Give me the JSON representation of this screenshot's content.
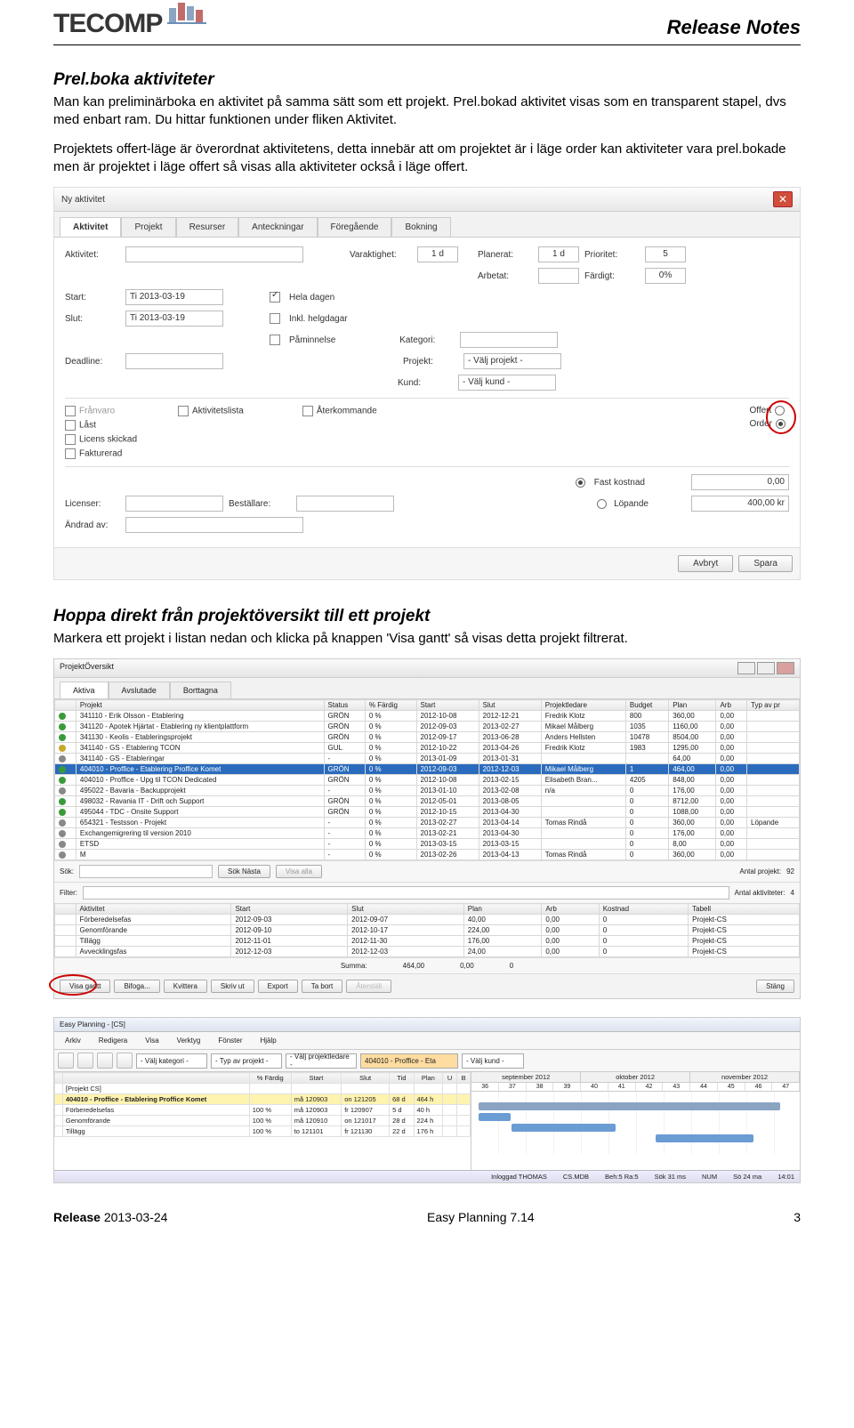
{
  "header": {
    "logo_text": "TECOMP",
    "title": "Release Notes"
  },
  "sec1": {
    "heading": "Prel.boka aktiviteter",
    "p1": "Man kan preliminärboka en aktivitet på samma sätt som ett projekt. Prel.bokad aktivitet visas som en transparent stapel, dvs med enbart ram. Du hittar funktionen under fliken Aktivitet.",
    "p2": "Projektets offert-läge är överordnat aktivitetens, detta innebär att om projektet är i läge order kan aktiviteter vara prel.bokade men är projektet i läge offert så visas alla aktiviteter också i läge offert."
  },
  "dlg": {
    "title": "Ny aktivitet",
    "tabs": [
      "Aktivitet",
      "Projekt",
      "Resurser",
      "Anteckningar",
      "Föregående",
      "Bokning"
    ],
    "labels": {
      "aktivitet": "Aktivitet:",
      "varaktighet": "Varaktighet:",
      "planerat": "Planerat:",
      "prioritet": "Prioritet:",
      "arbetat": "Arbetat:",
      "fardigt": "Färdigt:",
      "start": "Start:",
      "slut": "Slut:",
      "heladagen": "Hela dagen",
      "inkl": "Inkl. helgdagar",
      "paminnelse": "Påminnelse",
      "kategori": "Kategori:",
      "projekt": "Projekt:",
      "kund": "Kund:",
      "deadline": "Deadline:",
      "franvaro": "Frånvaro",
      "aktivitetslista": "Aktivitetslista",
      "aterkommande": "Återkommande",
      "last": "Låst",
      "licens": "Licens skickad",
      "fakturerad": "Fakturerad",
      "offert": "Offert",
      "order": "Order",
      "fastkostnad": "Fast kostnad",
      "lopande": "Löpande",
      "licenser": "Licenser:",
      "bestallare": "Beställare:",
      "andrad": "Ändrad av:"
    },
    "values": {
      "varaktighet": "1 d",
      "planerat": "1 d",
      "prioritet": "5",
      "fardigt": "0%",
      "start": "Ti 2013-03-19",
      "slut": "Ti 2013-03-19",
      "projekt": "- Välj projekt -",
      "kund": "- Välj kund -",
      "fastkostnad": "0,00",
      "lopande": "400,00 kr"
    },
    "buttons": {
      "avbryt": "Avbryt",
      "spara": "Spara"
    }
  },
  "sec2": {
    "heading": "Hoppa direkt från projektöversikt till ett projekt",
    "p": "Markera ett projekt i listan nedan och klicka på knappen 'Visa gantt' så visas detta projekt filtrerat."
  },
  "ov": {
    "title": "ProjektÖversikt",
    "tabs": [
      "Aktiva",
      "Avslutade",
      "Borttagna"
    ],
    "cols": [
      "",
      "Projekt",
      "Status",
      "% Färdig",
      "Start",
      "Slut",
      "Projektledare",
      "Budget",
      "Plan",
      "Arb",
      "Typ av pr"
    ],
    "rows": [
      [
        "g",
        "341110 - Erik Olsson - Etablering",
        "GRÖN",
        "0 %",
        "2012-10-08",
        "2012-12-21",
        "Fredrik Klotz",
        "800",
        "360,00",
        "0,00",
        ""
      ],
      [
        "g",
        "341120 - Apotek Hjärtat - Etablering ny klientplattform",
        "GRÖN",
        "0 %",
        "2012-09-03",
        "2013-02-27",
        "Mikael Målberg",
        "1035",
        "1160,00",
        "0,00",
        ""
      ],
      [
        "g",
        "341130 - Keolis - Etableringsprojekt",
        "GRÖN",
        "0 %",
        "2012-09-17",
        "2013-06-28",
        "Anders Hellsten",
        "10478",
        "8504,00",
        "0,00",
        ""
      ],
      [
        "y",
        "341140 - GS - Etablering TCON",
        "GUL",
        "0 %",
        "2012-10-22",
        "2013-04-26",
        "Fredrik Klotz",
        "1983",
        "1295,00",
        "0,00",
        ""
      ],
      [
        "d",
        "341140 - GS - Etableringar",
        "-",
        "0 %",
        "2013-01-09",
        "2013-01-31",
        "",
        "",
        "64,00",
        "0,00",
        ""
      ],
      [
        "sel",
        "404010 - Proffice - Etablering Proffice Komet",
        "GRÖN",
        "0 %",
        "2012-09-03",
        "2012-12-03",
        "Mikael Målberg",
        "1",
        "464,00",
        "0,00",
        ""
      ],
      [
        "g",
        "404010 - Proffice - Upg til TCON Dedicated",
        "GRÖN",
        "0 %",
        "2012-10-08",
        "2013-02-15",
        "Elisabeth Bran...",
        "4205",
        "848,00",
        "0,00",
        ""
      ],
      [
        "d",
        "495022 - Bavaria - Backupprojekt",
        "-",
        "0 %",
        "2013-01-10",
        "2013-02-08",
        "n/a",
        "0",
        "176,00",
        "0,00",
        ""
      ],
      [
        "g",
        "498032 - Ravania IT - Drift och Support",
        "GRÖN",
        "0 %",
        "2012-05-01",
        "2013-08-05",
        "",
        "0",
        "8712,00",
        "0,00",
        ""
      ],
      [
        "g",
        "495044 - TDC - Onsite Support",
        "GRÖN",
        "0 %",
        "2012-10-15",
        "2013-04-30",
        "",
        "0",
        "1088,00",
        "0,00",
        ""
      ],
      [
        "d",
        "654321 - Testsson - Projekt",
        "-",
        "0 %",
        "2013-02-27",
        "2013-04-14",
        "Tomas Rindå",
        "0",
        "360,00",
        "0,00",
        "Löpande"
      ],
      [
        "d",
        "Exchangemigrering til version 2010",
        "-",
        "0 %",
        "2013-02-21",
        "2013-04-30",
        "",
        "0",
        "176,00",
        "0,00",
        ""
      ],
      [
        "d",
        "ETSD",
        "-",
        "0 %",
        "2013-03-15",
        "2013-03-15",
        "",
        "0",
        "8,00",
        "0,00",
        ""
      ],
      [
        "d",
        "M",
        "-",
        "0 %",
        "2013-02-26",
        "2013-04-13",
        "Tomas Rindå",
        "0",
        "360,00",
        "0,00",
        ""
      ]
    ],
    "filter": {
      "sok": "Sök:",
      "soknasta": "Sök Nästa",
      "visaalla": "Visa alla",
      "filter": "Filter:",
      "antalp": "Antal projekt:",
      "antalpv": "92",
      "antala": "Antal aktiviteter:",
      "antalav": "4"
    },
    "sub": {
      "cols": [
        "",
        "Aktivitet",
        "Start",
        "Slut",
        "Plan",
        "Arb",
        "Kostnad",
        "Tabell"
      ],
      "rows": [
        [
          "",
          "Förberedelsefas",
          "2012-09-03",
          "2012-09-07",
          "40,00",
          "0,00",
          "0",
          "Projekt-CS"
        ],
        [
          "",
          "Genomförande",
          "2012-09-10",
          "2012-10-17",
          "224,00",
          "0,00",
          "0",
          "Projekt-CS"
        ],
        [
          "",
          "Tillägg",
          "2012-11-01",
          "2012-11-30",
          "176,00",
          "0,00",
          "0",
          "Projekt-CS"
        ],
        [
          "",
          "Avvecklingsfas",
          "2012-12-03",
          "2012-12-03",
          "24,00",
          "0,00",
          "0",
          "Projekt-CS"
        ]
      ],
      "summa": "Summa:",
      "s1": "464,00",
      "s2": "0,00",
      "s3": "0"
    },
    "btns": [
      "Visa gantt",
      "Bifoga...",
      "Kvittera",
      "Skriv ut",
      "Export",
      "Ta bort",
      "Återställ"
    ],
    "stang": "Stäng"
  },
  "gantt": {
    "title": "Easy Planning - [CS]",
    "menu": [
      "Arkiv",
      "Redigera",
      "Visa",
      "Verktyg",
      "Fönster",
      "Hjälp"
    ],
    "selproj": "404010 - Proffice - Eta",
    "cols": [
      "",
      "",
      "% Färdig",
      "Start",
      "Slut",
      "Tid",
      "Plan",
      "U",
      "B"
    ],
    "rows": [
      [
        "",
        "[Projekt CS]",
        "",
        "",
        "",
        "",
        "",
        "",
        ""
      ],
      [
        "",
        "404010 - Proffice - Etablering Proffice Komet",
        "",
        "må 120903",
        "on 121205",
        "68 d",
        "464 h",
        "",
        ""
      ],
      [
        "",
        "Förberedelsefas",
        "100 %",
        "må 120903",
        "fr 120907",
        "5 d",
        "40 h",
        "",
        ""
      ],
      [
        "",
        "Genomförande",
        "100 %",
        "må 120910",
        "on 121017",
        "28 d",
        "224 h",
        "",
        ""
      ],
      [
        "",
        "Tillägg",
        "100 %",
        "to 121101",
        "fr 121130",
        "22 d",
        "176 h",
        "",
        ""
      ]
    ],
    "months": [
      "september 2012",
      "oktober 2012",
      "november 2012"
    ],
    "weeks": [
      "36",
      "37",
      "38",
      "39",
      "40",
      "41",
      "42",
      "43",
      "44",
      "45",
      "46",
      "47"
    ],
    "status": [
      "Inloggad THOMAS",
      "CS.MDB",
      "Beh:5 Ra:5",
      "Sök 31 ms",
      "NUM",
      "Sö 24 ma",
      "14:01"
    ]
  },
  "footer": {
    "left_b": "Release ",
    "left": "2013-03-24",
    "mid": "Easy Planning 7.14",
    "right": "3"
  }
}
